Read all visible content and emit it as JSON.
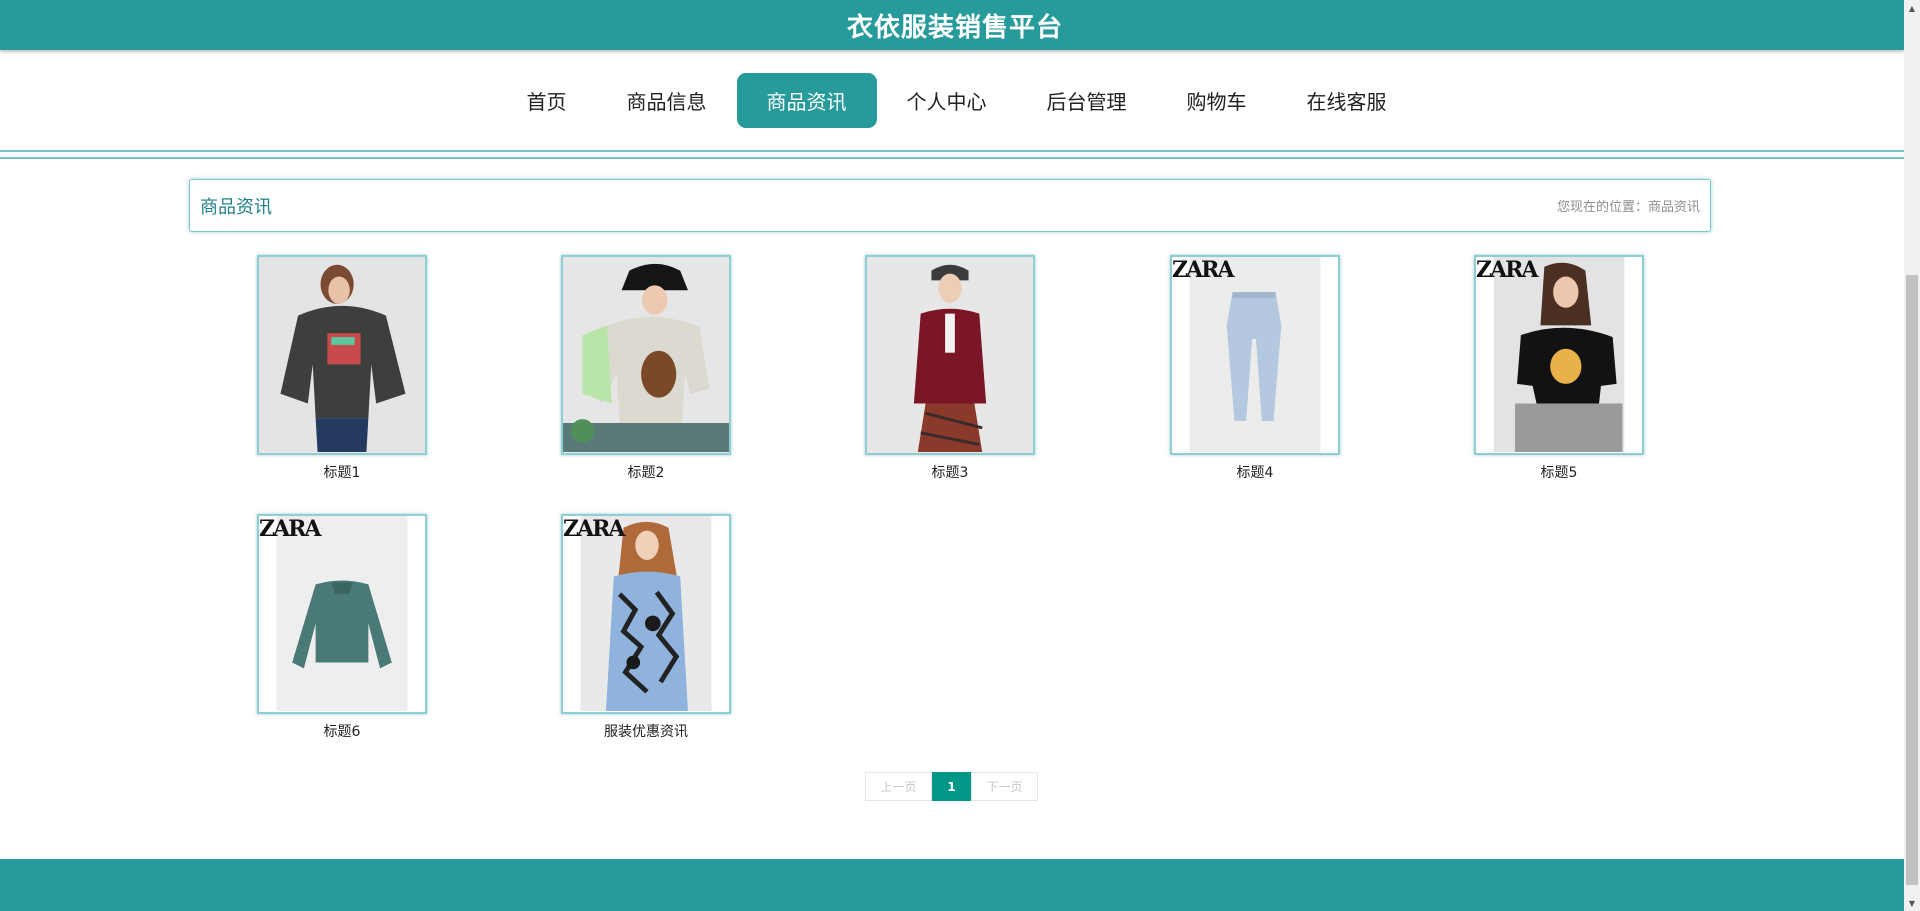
{
  "header": {
    "site_title": "衣依服装销售平台"
  },
  "nav": {
    "items": [
      {
        "label": "首页",
        "active": false
      },
      {
        "label": "商品信息",
        "active": false
      },
      {
        "label": "商品资讯",
        "active": true
      },
      {
        "label": "个人中心",
        "active": false
      },
      {
        "label": "后台管理",
        "active": false
      },
      {
        "label": "购物车",
        "active": false
      },
      {
        "label": "在线客服",
        "active": false
      }
    ]
  },
  "breadcrumb": {
    "title": "商品资讯",
    "location_text": "您现在的位置：商品资讯"
  },
  "news": {
    "items": [
      {
        "caption": "标题1",
        "image": "woman in dark grey graphic sweatshirt and jeans"
      },
      {
        "caption": "标题2",
        "image": "woman in black bucket hat and cream sweater"
      },
      {
        "caption": "标题3",
        "image": "woman in burgundy cardigan and plaid skirt"
      },
      {
        "caption": "标题4",
        "image": "light blue jeans",
        "brand_mark": "ZARA"
      },
      {
        "caption": "标题5",
        "image": "woman in black graphic t-shirt",
        "brand_mark": "ZARA"
      },
      {
        "caption": "标题6",
        "image": "teal cropped sweatshirt",
        "brand_mark": "ZARA"
      },
      {
        "caption": "服装优惠资讯",
        "image": "woman in blue floral print dress",
        "brand_mark": "ZARA"
      }
    ]
  },
  "pagination": {
    "prev_label": "上一页",
    "current_page": "1",
    "next_label": "下一页"
  },
  "colors": {
    "primary": "#279b9b",
    "page_active": "#009688"
  }
}
